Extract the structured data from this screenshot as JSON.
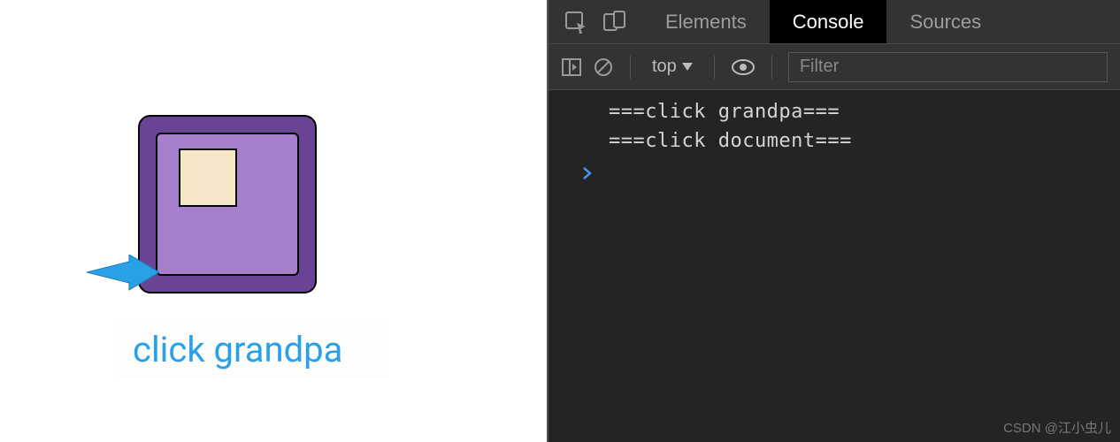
{
  "demo": {
    "label": "click grandpa"
  },
  "devtools": {
    "tabs": {
      "elements": "Elements",
      "console": "Console",
      "sources": "Sources"
    },
    "toolbar": {
      "context": "top",
      "filter_placeholder": "Filter"
    },
    "logs": [
      "===click grandpa===",
      "===click document==="
    ],
    "prompt": ">"
  },
  "watermark": "CSDN @江小虫儿"
}
